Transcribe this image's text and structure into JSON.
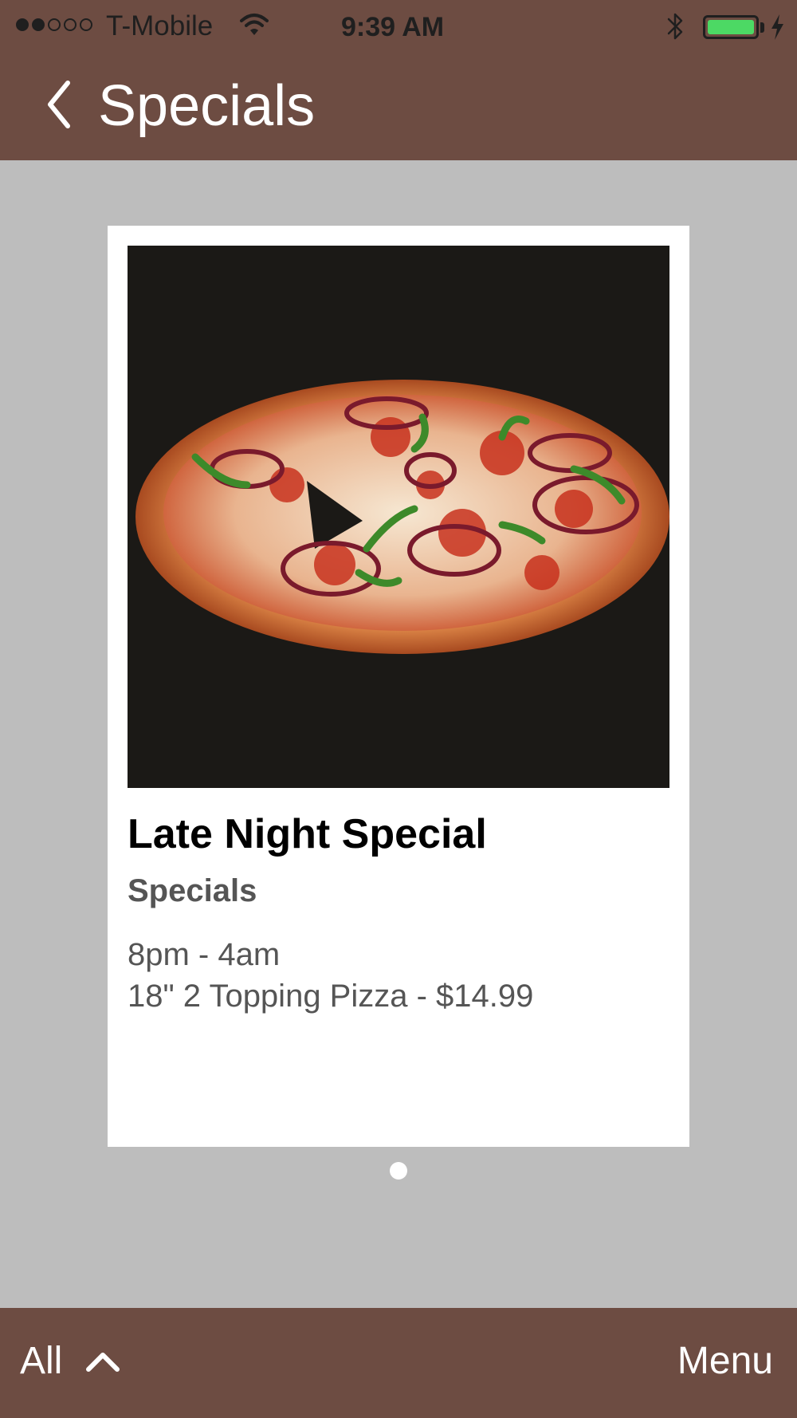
{
  "status_bar": {
    "signal_strength": "2 of 5",
    "carrier": "T-Mobile",
    "time": "9:39 AM",
    "wifi_icon": "wifi-icon",
    "bluetooth_icon": "bluetooth-icon",
    "battery_level": 1.0,
    "battery_color": "#4cd964",
    "charging_icon": "charging-bolt-icon"
  },
  "nav": {
    "back_icon": "chevron-left-icon",
    "title": "Specials",
    "bar_color": "#6d4c42"
  },
  "special": {
    "image_icon": "pizza-image",
    "title": "Late Night Special",
    "category": "Specials",
    "description": "8pm - 4am\n 18\" 2 Topping Pizza - $14.99"
  },
  "pager": {
    "current_page": 1,
    "total_pages": 1
  },
  "bottom_bar": {
    "filter_label": "All",
    "filter_icon": "chevron-up-icon",
    "menu_label": "Menu"
  },
  "colors": {
    "background": "#bdbdbd",
    "bar": "#6d4c42",
    "card": "#ffffff"
  }
}
